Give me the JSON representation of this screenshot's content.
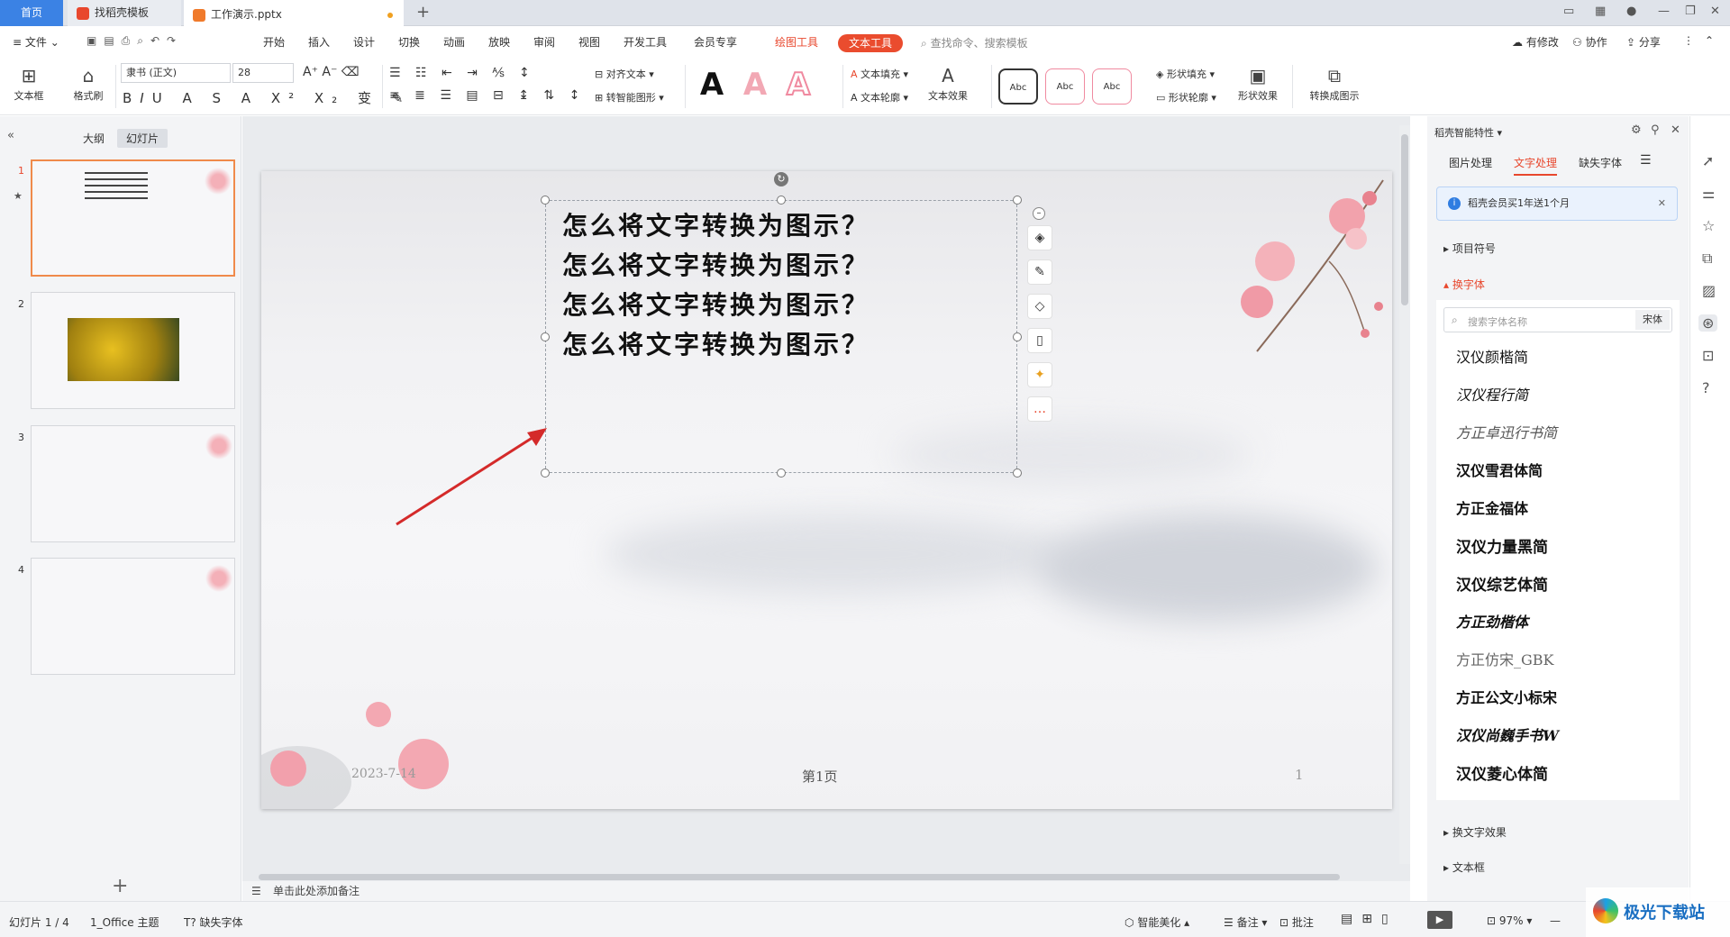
{
  "tabs": {
    "home": "首页",
    "template": "找稻壳模板",
    "file": "工作演示.pptx"
  },
  "menu": {
    "file": "文件",
    "items": [
      "开始",
      "插入",
      "设计",
      "切换",
      "动画",
      "放映",
      "审阅",
      "视图",
      "开发工具",
      "会员专享"
    ],
    "drawing_tools": "绘图工具",
    "text_tools": "文本工具",
    "search": "查找命令、搜索模板",
    "right": [
      "有修改",
      "协作",
      "分享"
    ]
  },
  "ribbon": {
    "textbox": "文本框",
    "format_painter": "格式刷",
    "font_name": "隶书 (正文)",
    "font_size": "28",
    "align_text": "对齐文本",
    "smart_shape": "转智能图形",
    "text_fill": "文本填充",
    "text_outline": "文本轮廓",
    "text_effect": "文本效果",
    "abc": [
      "Abc",
      "Abc",
      "Abc"
    ],
    "shape_fill": "形状填充",
    "shape_outline": "形状轮廓",
    "shape_effect": "形状效果",
    "convert_diagram": "转换成图示",
    "wordart": [
      "A",
      "A",
      "A"
    ]
  },
  "left_pane": {
    "tab_outline": "大纲",
    "tab_slides": "幻灯片",
    "slide_numbers": [
      "1",
      "2",
      "3",
      "4"
    ]
  },
  "slide": {
    "lines": [
      "怎么将文字转换为图示？",
      "怎么将文字转换为图示？",
      "怎么将文字转换为图示？",
      "怎么将文字转换为图示？"
    ],
    "date": "2023-7-14",
    "footer": "第1页",
    "page_num": "1"
  },
  "notes_placeholder": "单击此处添加备注",
  "right_pane": {
    "title": "稻壳智能特性",
    "tabs": [
      "图片处理",
      "文字处理",
      "缺失字体"
    ],
    "banner": "稻壳会员买1年送1个月",
    "sections": {
      "bullets": "项目符号",
      "change_font": "换字体",
      "text_effect": "换文字效果",
      "textbox": "文本框"
    },
    "font_search_placeholder": "搜索字体名称",
    "font_search_tag": "宋体",
    "fonts": [
      "汉仪颜楷简",
      "汉仪程行简",
      "方正卓迅行书简",
      "汉仪雪君体简",
      "方正金福体",
      "汉仪力量黑简",
      "汉仪综艺体简",
      "方正劲楷体",
      "方正仿宋_GBK",
      "方正公文小标宋",
      "汉仪尚巍手书W",
      "汉仪菱心体简"
    ]
  },
  "status": {
    "slide_info": "幻灯片 1 / 4",
    "theme": "1_Office 主题",
    "missing_font": "缺失字体",
    "smart_beautify": "智能美化",
    "notes": "备注",
    "comments": "批注",
    "zoom": "97%"
  },
  "watermark": "极光下载站"
}
